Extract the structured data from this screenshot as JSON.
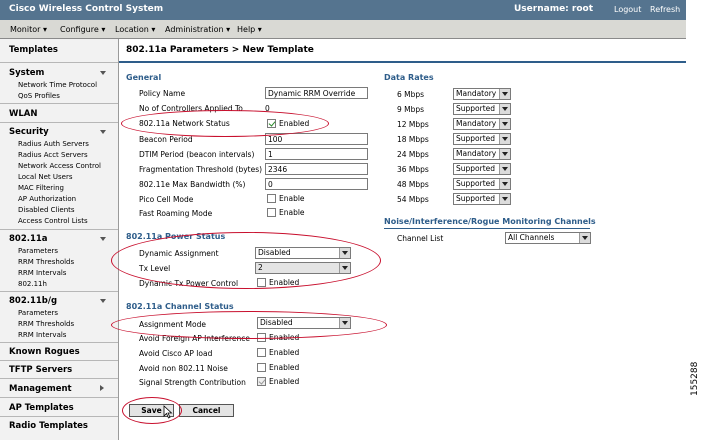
{
  "app": {
    "title": "Cisco Wireless Control System",
    "username_label": "Username: root",
    "logout": "Logout",
    "refresh": "Refresh"
  },
  "menu": [
    {
      "label": "Monitor",
      "arrow": "▾"
    },
    {
      "label": "Configure",
      "arrow": "▾"
    },
    {
      "label": "Location",
      "arrow": "▾"
    },
    {
      "label": "Administration",
      "arrow": "▾"
    },
    {
      "label": "Help",
      "arrow": "▾"
    }
  ],
  "sidebar": {
    "templates": "Templates",
    "system": "System",
    "system_items": [
      "Network Time Protocol",
      "QoS Profiles"
    ],
    "wlan": "WLAN",
    "security": "Security",
    "security_items": [
      "Radius Auth Servers",
      "Radius Acct Servers",
      "Network Access Control",
      "Local Net Users",
      "MAC Filtering",
      "AP Authorization",
      "Disabled Clients",
      "Access Control Lists"
    ],
    "a": "802.11a",
    "a_items": [
      "Parameters",
      "RRM Thresholds",
      "RRM Intervals",
      "802.11h"
    ],
    "bg": "802.11b/g",
    "bg_items": [
      "Parameters",
      "RRM Thresholds",
      "RRM Intervals"
    ],
    "rogues": "Known Rogues",
    "tftp": "TFTP Servers",
    "mgmt": "Management",
    "ap": "AP Templates",
    "radio": "Radio Templates"
  },
  "page": {
    "title": "802.11a Parameters > New Template"
  },
  "general": {
    "heading": "General",
    "policy_name_label": "Policy Name",
    "policy_name_value": "Dynamic RRM Override",
    "controllers_label": "No of Controllers Applied To",
    "controllers_value": "0",
    "network_status_label": "802.11a Network Status",
    "enabled_text": "Enabled",
    "enable_text": "Enable",
    "beacon_label": "Beacon Period",
    "beacon_value": "100",
    "dtim_label": "DTIM Period (beacon intervals)",
    "dtim_value": "1",
    "frag_label": "Fragmentation Threshold (bytes)",
    "frag_value": "2346",
    "bw_label": "802.11e Max Bandwidth (%)",
    "bw_value": "0",
    "pico_label": "Pico Cell Mode",
    "fast_label": "Fast Roaming Mode"
  },
  "power": {
    "heading": "802.11a Power Status",
    "dyn_label": "Dynamic Assignment",
    "dyn_value": "Disabled",
    "tx_label": "Tx Level",
    "tx_value": "2",
    "dtpc_label": "Dynamic Tx Power Control",
    "enabled_text": "Enabled"
  },
  "channel": {
    "heading": "802.11a Channel Status",
    "mode_label": "Assignment Mode",
    "mode_value": "Disabled",
    "foreign_label": "Avoid Foreign AP Interference",
    "cisco_label": "Avoid Cisco AP load",
    "noise_label": "Avoid non 802.11 Noise",
    "signal_label": "Signal Strength Contribution",
    "enabled_text": "Enabled"
  },
  "rates": {
    "heading": "Data Rates",
    "rows": [
      {
        "rate": "6 Mbps",
        "value": "Mandatory"
      },
      {
        "rate": "9 Mbps",
        "value": "Supported"
      },
      {
        "rate": "12 Mbps",
        "value": "Mandatory"
      },
      {
        "rate": "18 Mbps",
        "value": "Supported"
      },
      {
        "rate": "24 Mbps",
        "value": "Mandatory"
      },
      {
        "rate": "36 Mbps",
        "value": "Supported"
      },
      {
        "rate": "48 Mbps",
        "value": "Supported"
      },
      {
        "rate": "54 Mbps",
        "value": "Supported"
      }
    ]
  },
  "noise": {
    "heading": "Noise/Interference/Rogue Monitoring Channels",
    "channel_list_label": "Channel List",
    "channel_list_value": "All Channels"
  },
  "buttons": {
    "save": "Save",
    "cancel": "Cancel"
  },
  "figure_number": "155288",
  "colors": {
    "titlebar": "#55748f",
    "section_heading": "#2e5d8a",
    "annotation": "#c8102e"
  }
}
